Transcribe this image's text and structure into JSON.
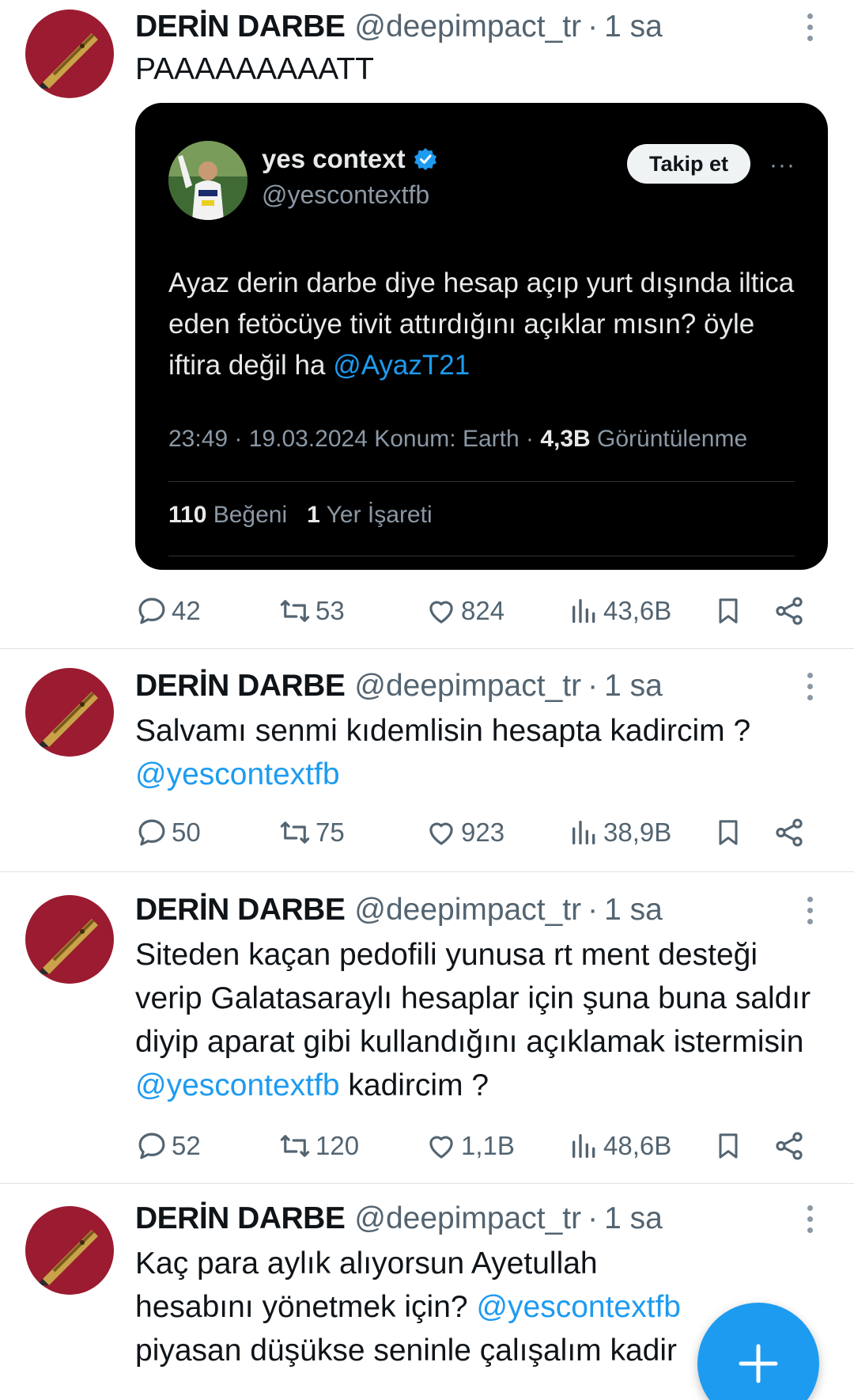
{
  "tweets": [
    {
      "name": "DERİN DARBE",
      "handle": "@deepimpact_tr",
      "separator": "·",
      "time": "1 sa",
      "text_parts": [
        "PAAAAAAAAATT"
      ],
      "embedded": {
        "name": "yes context",
        "handle": "@yescontextfb",
        "follow_label": "Takip et",
        "more_label": "···",
        "text": "Ayaz derin darbe diye hesap açıp yurt dışında iltica eden fetöcüye tivit attırdığını açıklar mısın? öyle iftira değil ha",
        "mention": "@AyazT21",
        "meta_prefix": "23:49 · 19.03.2024 Konum: Earth · ",
        "views_count": "4,3B",
        "views_label": " Görüntülenme",
        "likes_count": "110",
        "likes_label": " Beğeni",
        "bookmarks_count": "1",
        "bookmarks_label": " Yer İşareti"
      },
      "replies": "42",
      "retweets": "53",
      "likes": "824",
      "views": "43,6B"
    },
    {
      "name": "DERİN DARBE",
      "handle": "@deepimpact_tr",
      "separator": "·",
      "time": "1 sa",
      "text_a": "Salvamı senmi kıdemlisin hesapta kadircim ?",
      "mention": "@yescontextfb",
      "replies": "50",
      "retweets": "75",
      "likes": "923",
      "views": "38,9B"
    },
    {
      "name": "DERİN DARBE",
      "handle": "@deepimpact_tr",
      "separator": "·",
      "time": "1 sa",
      "text_a": "Siteden kaçan pedofili yunusa rt ment desteği verip Galatasaraylı hesaplar için şuna buna saldır diyip aparat gibi kullandığını açıklamak istermisin",
      "mention": "@yescontextfb",
      "text_b": "kadircim ?",
      "replies": "52",
      "retweets": "120",
      "likes": "1,1B",
      "views": "48,6B"
    },
    {
      "name": "DERİN DARBE",
      "handle": "@deepimpact_tr",
      "separator": "·",
      "time": "1 sa",
      "text_a": "Kaç para aylık alıyorsun Ayetullah hesabını yönetmek için?",
      "mention": "@yescontextfb",
      "text_b": "piyasan düşükse seninle çalışalım kadir"
    }
  ],
  "icons": {
    "reply": "reply-icon",
    "retweet": "retweet-icon",
    "like": "heart-icon",
    "views": "views-icon",
    "bookmark": "bookmark-icon",
    "share": "share-icon",
    "compose": "plus-icon"
  },
  "colors": {
    "accent": "#1d9bf0",
    "avatar_bg": "#9b1b30",
    "muted": "#536471"
  }
}
